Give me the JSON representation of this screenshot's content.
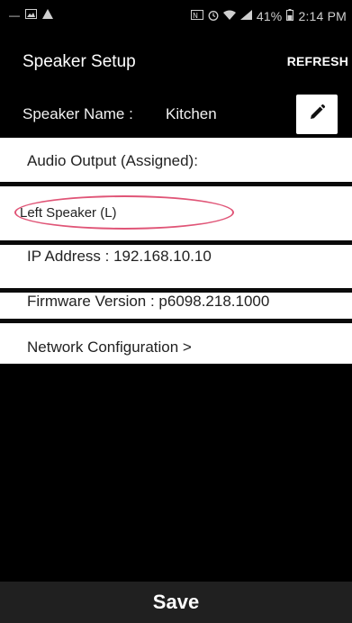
{
  "status_bar": {
    "battery": "41%",
    "time": "2:14 PM"
  },
  "header": {
    "title": "Speaker Setup",
    "refresh_label": "REFRESH"
  },
  "speaker_name": {
    "label": "Speaker Name :",
    "value": "Kitchen"
  },
  "rows": {
    "audio_output": "Audio Output (Assigned):",
    "speaker_channel": "Left Speaker (L)",
    "ip_address": "IP  Address : 192.168.10.10",
    "firmware": "Firmware  Version : p6098.218.1000",
    "network": "Network  Configuration >"
  },
  "save_label": "Save",
  "colors": {
    "highlight_ellipse": "#e05577",
    "background": "#000000",
    "row_background": "#ffffff"
  }
}
